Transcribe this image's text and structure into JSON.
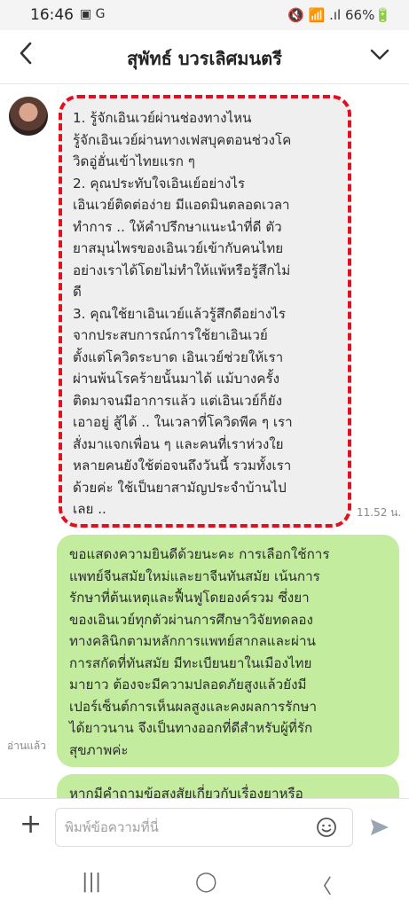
{
  "status_bar": {
    "time": "16:46",
    "left_icons": "▣ G",
    "right": "🔇 📶 .ıl 66%🔋"
  },
  "header": {
    "title": "สุพัทธ์ บวรเลิศมนตรี",
    "back_icon": "chevron-left",
    "menu_icon": "chevron-down"
  },
  "messages": {
    "incoming": {
      "text": "1. รู้จักเอินเวย์ผ่านช่องทางไหน\nรู้จักเอินเวย์ผ่านทางเฟสบุคตอนช่วงโค\nวิดอู่ฮั่นเข้าไทยแรก ๆ\n2. คุณประทับใจเอินเย์อย่างไร\nเอินเวย์ติดต่อง่าย มีแอดมินตลอดเวลา\nทำการ .. ให้คำปรึกษาแนะนำที่ดี ตัว\nยาสมุนไพรของเอินเวย์เข้ากับคนไทย\nอย่างเราได้โดยไม่ทำให้แพ้หรือรู้สึกไม่\nดี\n3. คุณใช้ยาเอินเวย์แล้วรู้สึกดีอย่างไร\nจากประสบการณ์การใช้ยาเอินเวย์\nตั้งแต่โควิดระบาด เอินเวย์ช่วยให้เรา\nผ่านพ้นโรคร้ายนั้นมาได้ แม้บางครั้ง\nติดมาจนมีอาการแล้ว แต่เอินเวย์ก็ยัง\nเอาอยู่ สู้ได้ .. ในเวลาที่โควิดพีค ๆ เรา\nสั่งมาแจกเพื่อน ๆ และคนที่เราห่วงใย\nหลายคนยังใช้ต่อจนถึงวันนี้ รวมทั้งเรา\nด้วยค่ะ ใช้เป็นยาสามัญประจำบ้านไป\nเลย ..",
      "time": "11.52 น."
    },
    "outgoing": {
      "text": "ขอแสดงความยินดีด้วยนะคะ การเลือกใช้การ\nแพทย์จีนสมัยใหม่และยาจีนทันสมัย เน้นการ\nรักษาที่ต้นเหตุและฟื้นฟูโดยองค์รวม ซึ่งยา\nของเอินเวย์ทุกตัวผ่านการศึกษาวิจัยทดลอง\nทางคลินิกตามหลักการแพทย์สากลและผ่าน\nการสกัดที่ทันสมัย มีทะเบียนยาในเมืองไทย\nมายาว ต้องจะมีความปลอดภัยสูงแล้วยังมี\nเปอร์เซ็นต์การเห็นผลสูงและคงผลการรักษา\nได้ยาวนาน จึงเป็นทางออกที่ดีสำหรับผู้ที่รัก\nสุขภาพค่ะ",
      "read_label": "อ่านแล้ว"
    },
    "outgoing2": {
      "text": "หากมีคำถามข้อสงสัยเกี่ยวกับเรื่องยาหรือ"
    }
  },
  "composer": {
    "placeholder": "พิมพ์ข้อความที่นี่",
    "plus_icon": "plus",
    "emoji_icon": "smiley",
    "send_icon": "send-arrow"
  },
  "navbar": {
    "recent": "|||",
    "home": "◯",
    "back": "〈"
  }
}
